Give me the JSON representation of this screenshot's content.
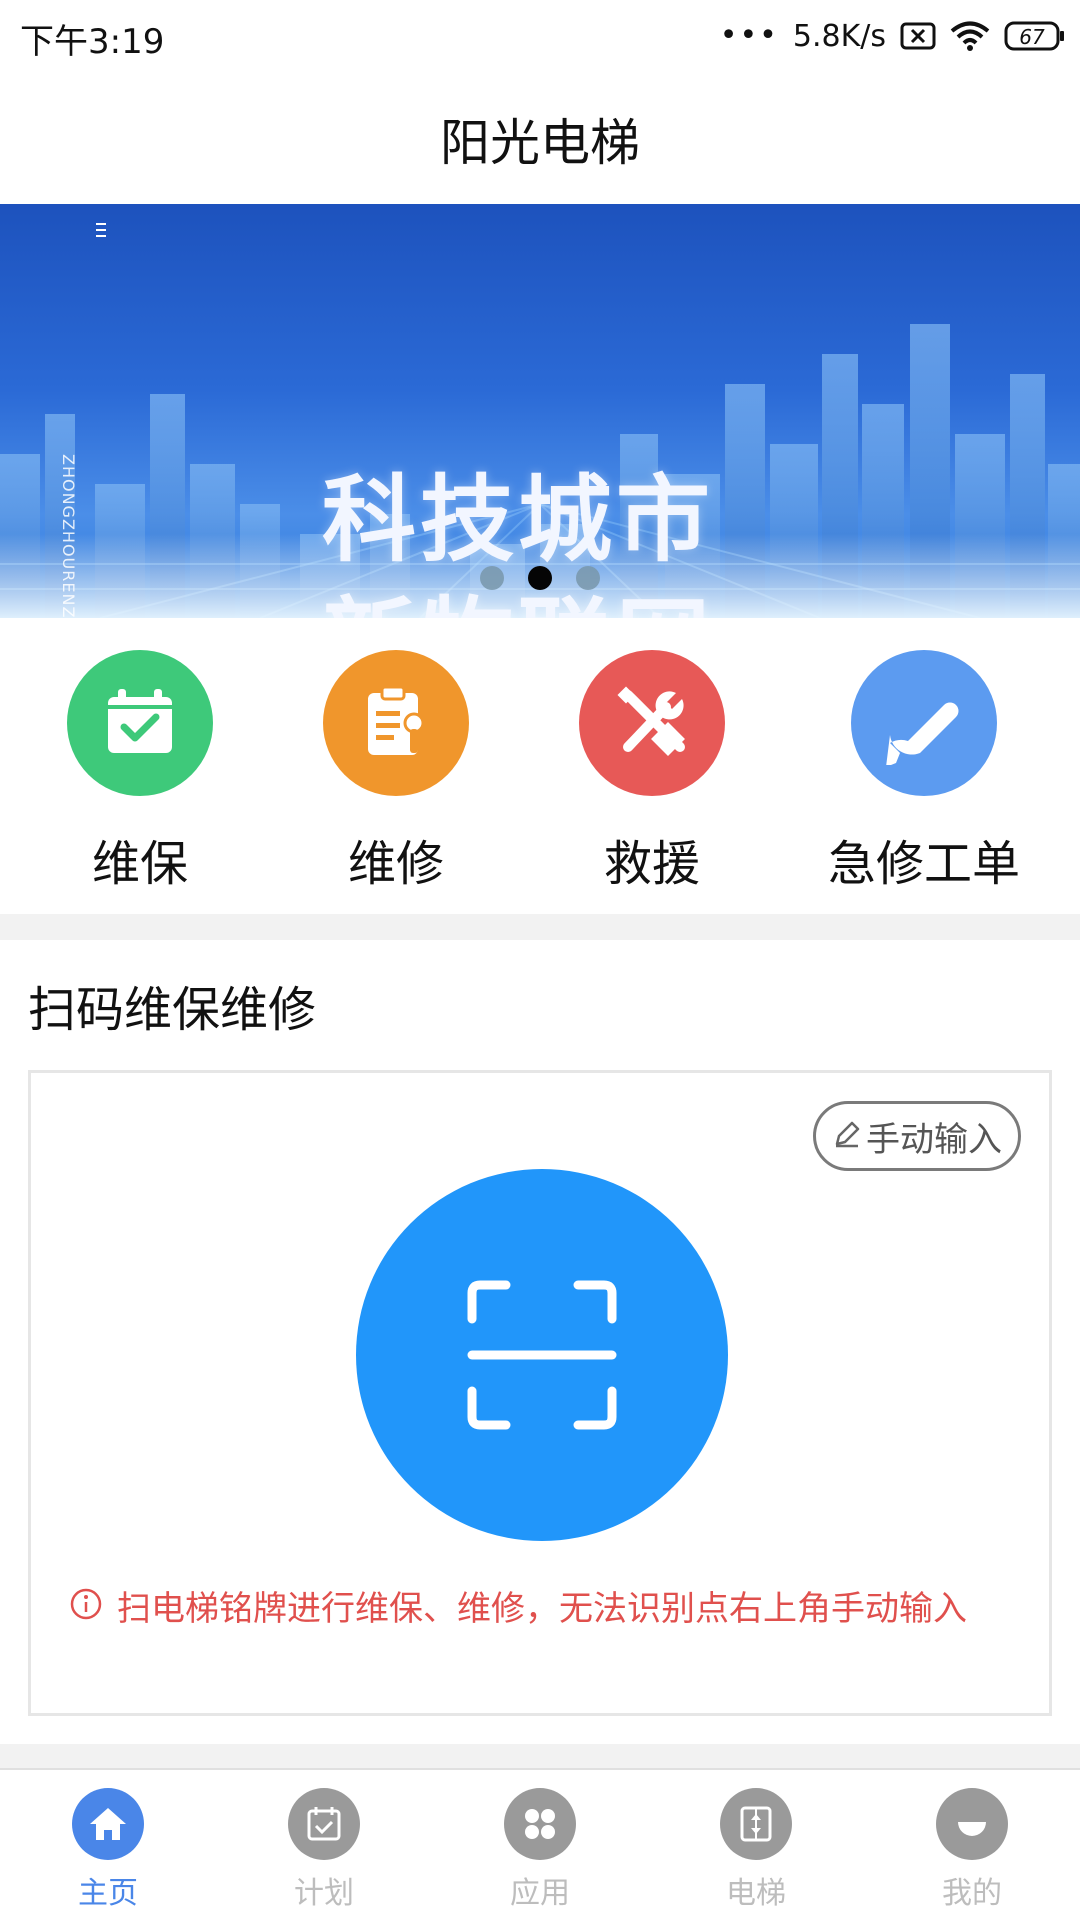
{
  "status_bar": {
    "time": "下午3:19",
    "dots": "•••",
    "net_speed": "5.8K/s",
    "battery": "67",
    "icons": [
      "sim-off-icon",
      "wifi-icon",
      "battery-icon"
    ]
  },
  "header": {
    "title": "阳光电梯"
  },
  "banner": {
    "line1": "科技城市",
    "line2": "新物联网",
    "vertical_text": "ZHONGZHOURENZHENGJIANCE",
    "pager": {
      "count": 3,
      "active_index": 1
    }
  },
  "quick_actions": [
    {
      "label": "维保",
      "icon": "calendar-check-icon",
      "color": "#3ec97a"
    },
    {
      "label": "维修",
      "icon": "clipboard-wrench-icon",
      "color": "#f0962c"
    },
    {
      "label": "救援",
      "icon": "tools-cross-icon",
      "color": "#e75957"
    },
    {
      "label": "急修工单",
      "icon": "wrench-icon",
      "color": "#5c9bf0"
    }
  ],
  "scan_section": {
    "title": "扫码维保维修",
    "manual_button": "手动输入",
    "hint": "扫电梯铭牌进行维保、维修，无法识别点右上角手动输入",
    "scan_color": "#2196fa",
    "hint_color": "#e0504d"
  },
  "bottom_nav": {
    "active": "主页",
    "active_color": "#4a86e8",
    "items": [
      {
        "label": "主页",
        "icon": "home-icon"
      },
      {
        "label": "计划",
        "icon": "calendar-icon"
      },
      {
        "label": "应用",
        "icon": "apps-grid-icon"
      },
      {
        "label": "电梯",
        "icon": "elevator-icon"
      },
      {
        "label": "我的",
        "icon": "user-icon"
      }
    ]
  }
}
